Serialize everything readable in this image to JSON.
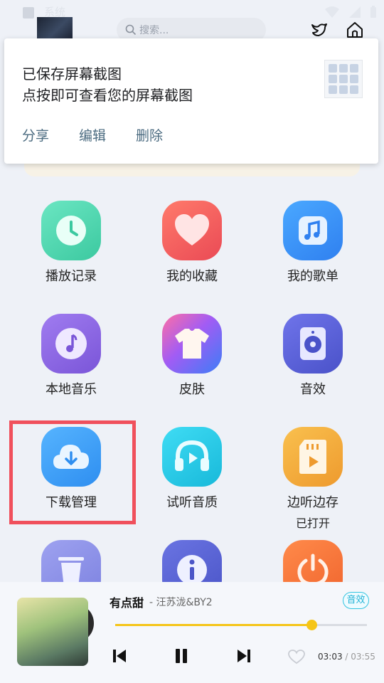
{
  "statusbar": {
    "title": "系统"
  },
  "header": {
    "search_placeholder": "搜索..."
  },
  "notification": {
    "line1": "已保存屏幕截图",
    "line2": "点按即可查看您的屏幕截图",
    "actions": [
      "分享",
      "编辑",
      "删除"
    ]
  },
  "grid": {
    "items": [
      {
        "label": "播放记录",
        "icon": "clock-icon",
        "color": "#4fd8b0"
      },
      {
        "label": "我的收藏",
        "icon": "heart-icon",
        "color": "#f05a5a"
      },
      {
        "label": "我的歌单",
        "icon": "music-note-icon",
        "color": "#2f8ff4"
      },
      {
        "label": "本地音乐",
        "icon": "music-disc-icon",
        "color": "#8a66e0"
      },
      {
        "label": "皮肤",
        "icon": "tshirt-icon",
        "color": "#6b5ef0"
      },
      {
        "label": "音效",
        "icon": "speaker-icon",
        "color": "#5b63d8"
      },
      {
        "label": "下载管理",
        "icon": "cloud-download-icon",
        "color": "#3e9af5"
      },
      {
        "label": "试听音质",
        "icon": "headphones-icon",
        "color": "#21c8e6"
      },
      {
        "label": "边听边存",
        "sub": "已打开",
        "icon": "sd-card-icon",
        "color": "#f2a43a"
      },
      {
        "label": "",
        "icon": "trash-icon",
        "color": "#8a8ee6"
      },
      {
        "label": "",
        "icon": "info-icon",
        "color": "#5a66d6"
      },
      {
        "label": "",
        "icon": "power-icon",
        "color": "#f4743a"
      }
    ]
  },
  "player": {
    "song": "有点甜",
    "artist": "- 汪苏泷&BY2",
    "fx_badge": "音效",
    "progress": 0.78,
    "current_time": "03:03",
    "duration": "03:55"
  }
}
